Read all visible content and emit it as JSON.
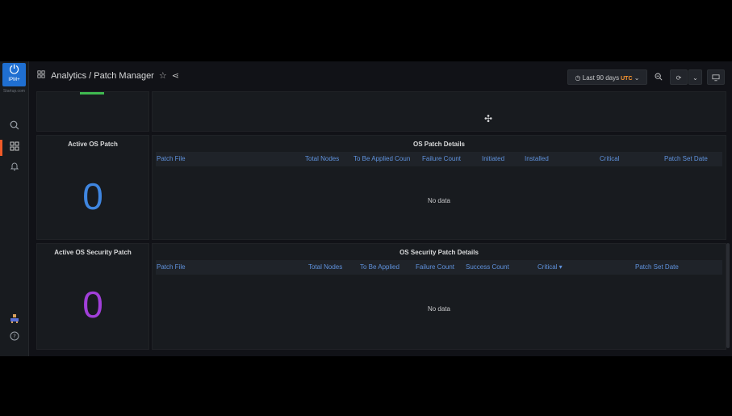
{
  "app": {
    "logo_glyph": "⏻",
    "logo_text": "IPM+",
    "logo_subtext": "Startup.com"
  },
  "sidebar": {
    "icons": [
      "search-icon",
      "dashboards-icon",
      "alerts-bell-icon",
      "user-avatar-icon",
      "help-icon"
    ]
  },
  "header": {
    "breadcrumb": "Analytics / Patch Manager",
    "time_range": "Last 90 days",
    "timezone": "UTC"
  },
  "panels": {
    "active_os_patch": {
      "title": "Active OS Patch",
      "value": "0",
      "color": "#3f86e0"
    },
    "os_patch_details": {
      "title": "OS Patch Details",
      "columns": [
        "Patch File",
        "Total Nodes",
        "To Be Applied Coun",
        "Failure Count",
        "Initiated",
        "Installed",
        "Critical",
        "Patch Set Date"
      ],
      "empty_text": "No data"
    },
    "active_os_security_patch": {
      "title": "Active OS Security Patch",
      "value": "0",
      "color": "#a13fd9"
    },
    "os_security_patch_details": {
      "title": "OS Security Patch Details",
      "columns": [
        "Patch File",
        "Total Nodes",
        "To Be Applied",
        "Failure Count",
        "Success Count",
        "Critical ▾",
        "Patch Set Date"
      ],
      "empty_text": "No data"
    }
  }
}
